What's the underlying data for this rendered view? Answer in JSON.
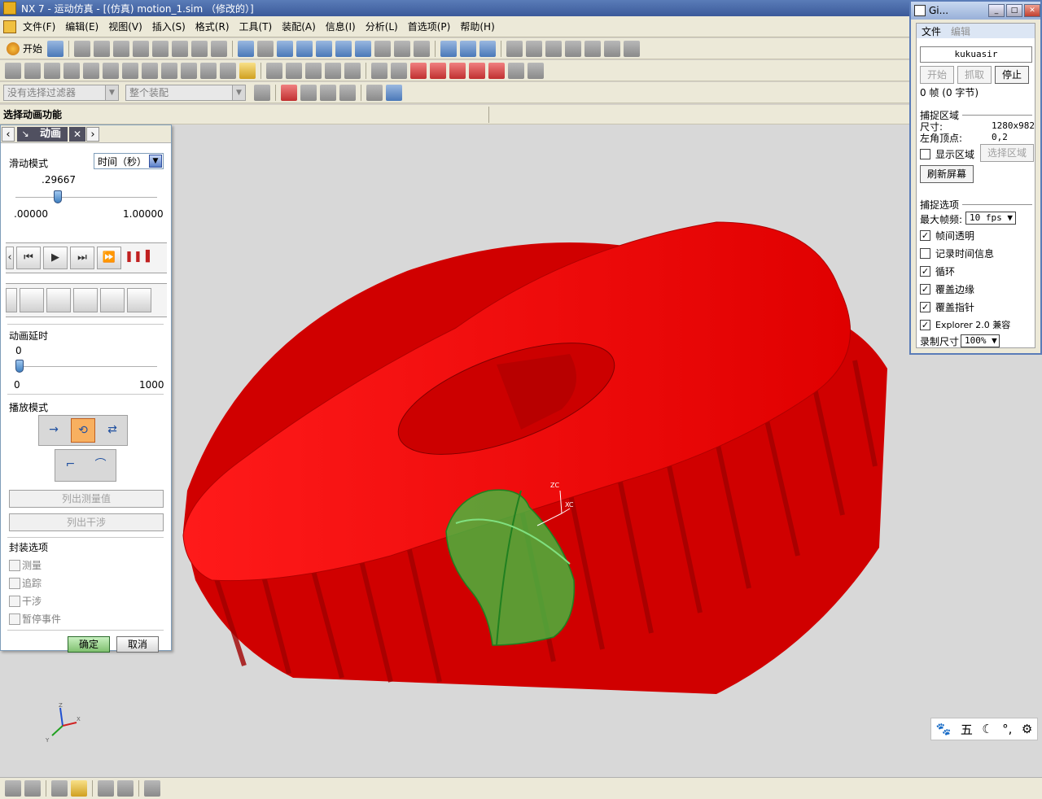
{
  "window": {
    "app_name": "NX 7 - 运动仿真 - [(仿真) motion_1.sim （修改的）]"
  },
  "menu": {
    "start": "开始",
    "items": [
      "文件(F)",
      "编辑(E)",
      "视图(V)",
      "插入(S)",
      "格式(R)",
      "工具(T)",
      "装配(A)",
      "信息(I)",
      "分析(L)",
      "首选项(P)",
      "帮助(H)"
    ]
  },
  "toolbar": {
    "filter_placeholder": "没有选择过滤器",
    "assembly_scope": "整个装配"
  },
  "cue_line": "选择动画功能",
  "dialog": {
    "tab_label": "动画",
    "slider_mode_label": "滑动模式",
    "slider_mode_value": "时间（秒）",
    "time_value": ".29667",
    "time_fraction": 0.29667,
    "time_min": ".00000",
    "time_max": "1.00000",
    "delay_label": "动画延时",
    "delay_value": "0",
    "delay_min": "0",
    "delay_max": "1000",
    "play_mode_label": "播放模式",
    "list_measure": "列出测量值",
    "list_interference": "列出干涉",
    "package_label": "封装选项",
    "package_options": [
      "测量",
      "追踪",
      "干涉",
      "暂停事件"
    ],
    "ok": "确定",
    "cancel": "取消"
  },
  "recorder": {
    "title": "Gi...",
    "menu_file": "文件",
    "menu_edit": "编辑",
    "author": "kukuasir",
    "btn_start": "开始",
    "btn_grab": "抓取",
    "btn_stop": "停止",
    "frames": "0 帧 (0 字节)",
    "capture_area_label": "捕捉区域",
    "size_label": "尺寸:",
    "size_value": "1280x982",
    "topleft_label": "左角顶点:",
    "topleft_value": "0,2",
    "show_area": "显示区域",
    "select_area": "选择区域",
    "refresh": "刷新屏幕",
    "capture_options_label": "捕捉选项",
    "max_fps_label": "最大帧频:",
    "max_fps_value": "10 fps",
    "options": [
      {
        "label": "帧间透明",
        "checked": true
      },
      {
        "label": "记录时间信息",
        "checked": false
      },
      {
        "label": "循环",
        "checked": true
      },
      {
        "label": "覆盖边缘",
        "checked": true
      },
      {
        "label": "覆盖指针",
        "checked": true
      },
      {
        "label": "Explorer 2.0 兼容",
        "checked": true
      }
    ],
    "record_size_label": "录制尺寸",
    "record_size_value": "100%"
  },
  "viewport": {
    "triad_labels": [
      "Z",
      "Y",
      "X"
    ],
    "csys_labels": [
      "ZC",
      "XC"
    ]
  },
  "ime": {
    "mode": "五"
  },
  "colors": {
    "gear": "#ff0000",
    "worm": "#40c040",
    "viewport_bg": "#d8d8d8"
  }
}
